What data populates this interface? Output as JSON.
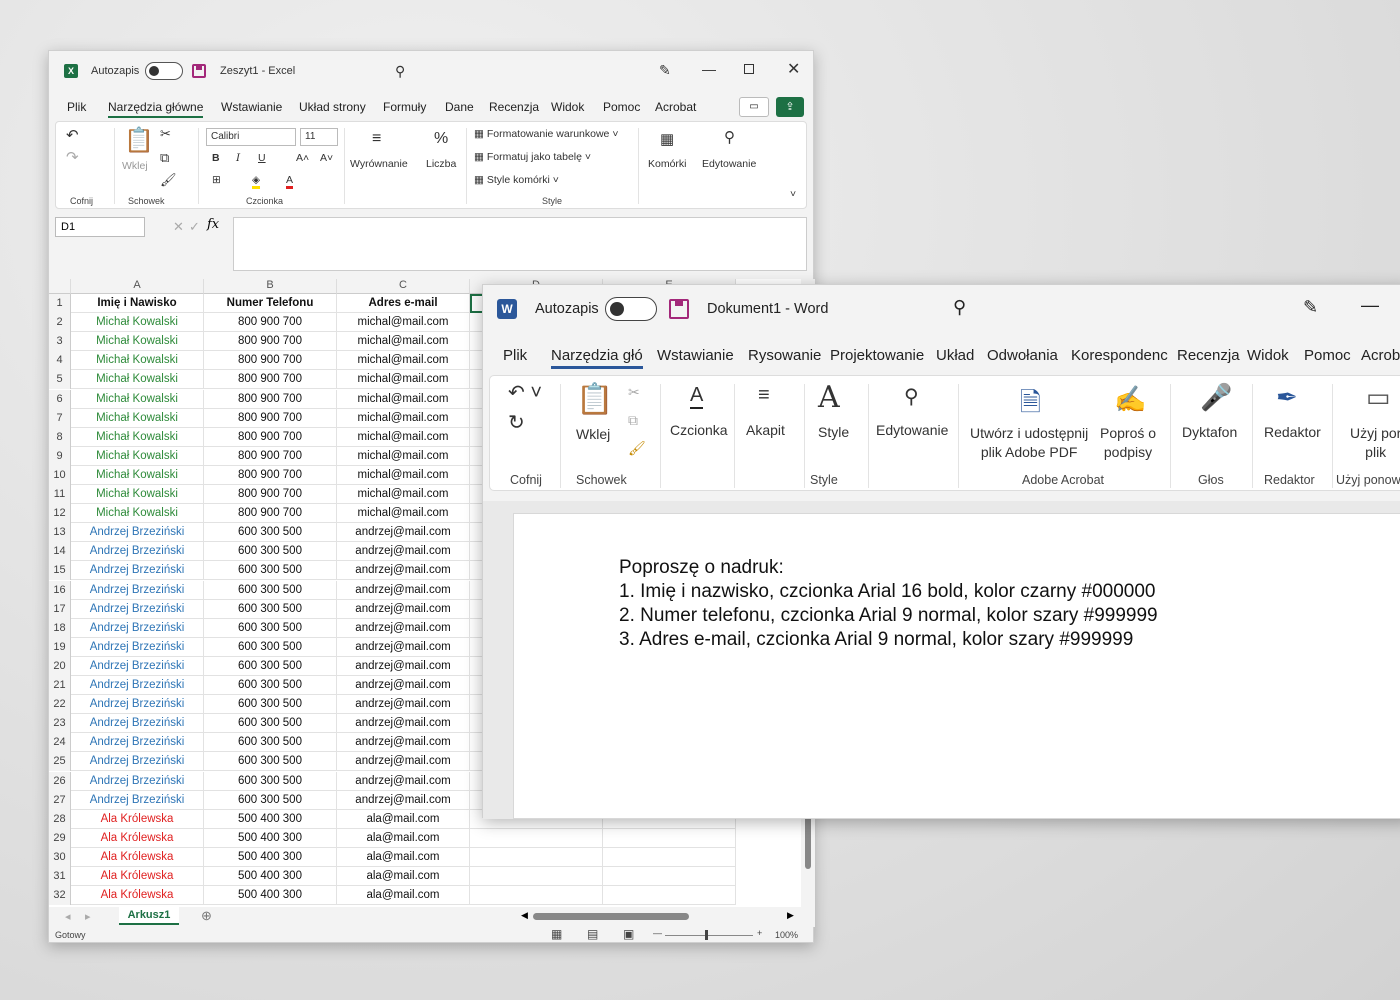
{
  "excel": {
    "app_icon": "excel-icon",
    "autosave_label": "Autozapis",
    "title": "Zeszyt1  -  Excel",
    "tabs": [
      "Plik",
      "Narzędzia główne",
      "Wstawianie",
      "Układ strony",
      "Formuły",
      "Dane",
      "Recenzja",
      "Widok",
      "Pomoc",
      "Acrobat"
    ],
    "ribbon": {
      "font_name": "Calibri",
      "font_size": "11",
      "paste_label": "Wklej",
      "alignment_label": "Wyrównanie",
      "number_label": "Liczba",
      "cond_format": "Formatowanie warunkowe",
      "format_table": "Formatuj jako tabelę",
      "cell_styles": "Style komórki",
      "cells_label": "Komórki",
      "editing_label": "Edytowanie",
      "groups": {
        "undo": "Cofnij",
        "clipboard": "Schowek",
        "font": "Czcionka",
        "style": "Style"
      }
    },
    "namebox": "D1",
    "fx_label": "fx",
    "columns": [
      "A",
      "B",
      "C",
      "D",
      "E"
    ],
    "headers": [
      "Imię i Nawisko",
      "Numer Telefonu",
      "Adres e-mail"
    ],
    "rows": [
      [
        "Michał Kowalski",
        "800 900 700",
        "michal@mail.com",
        "green"
      ],
      [
        "Michał Kowalski",
        "800 900 700",
        "michal@mail.com",
        "green"
      ],
      [
        "Michał Kowalski",
        "800 900 700",
        "michal@mail.com",
        "green"
      ],
      [
        "Michał Kowalski",
        "800 900 700",
        "michal@mail.com",
        "green"
      ],
      [
        "Michał Kowalski",
        "800 900 700",
        "michal@mail.com",
        "green"
      ],
      [
        "Michał Kowalski",
        "800 900 700",
        "michal@mail.com",
        "green"
      ],
      [
        "Michał Kowalski",
        "800 900 700",
        "michal@mail.com",
        "green"
      ],
      [
        "Michał Kowalski",
        "800 900 700",
        "michal@mail.com",
        "green"
      ],
      [
        "Michał Kowalski",
        "800 900 700",
        "michal@mail.com",
        "green"
      ],
      [
        "Michał Kowalski",
        "800 900 700",
        "michal@mail.com",
        "green"
      ],
      [
        "Michał Kowalski",
        "800 900 700",
        "michal@mail.com",
        "green"
      ],
      [
        "Andrzej Brzeziński",
        "600 300 500",
        "andrzej@mail.com",
        "blue"
      ],
      [
        "Andrzej Brzeziński",
        "600 300 500",
        "andrzej@mail.com",
        "blue"
      ],
      [
        "Andrzej Brzeziński",
        "600 300 500",
        "andrzej@mail.com",
        "blue"
      ],
      [
        "Andrzej Brzeziński",
        "600 300 500",
        "andrzej@mail.com",
        "blue"
      ],
      [
        "Andrzej Brzeziński",
        "600 300 500",
        "andrzej@mail.com",
        "blue"
      ],
      [
        "Andrzej Brzeziński",
        "600 300 500",
        "andrzej@mail.com",
        "blue"
      ],
      [
        "Andrzej Brzeziński",
        "600 300 500",
        "andrzej@mail.com",
        "blue"
      ],
      [
        "Andrzej Brzeziński",
        "600 300 500",
        "andrzej@mail.com",
        "blue"
      ],
      [
        "Andrzej Brzeziński",
        "600 300 500",
        "andrzej@mail.com",
        "blue"
      ],
      [
        "Andrzej Brzeziński",
        "600 300 500",
        "andrzej@mail.com",
        "blue"
      ],
      [
        "Andrzej Brzeziński",
        "600 300 500",
        "andrzej@mail.com",
        "blue"
      ],
      [
        "Andrzej Brzeziński",
        "600 300 500",
        "andrzej@mail.com",
        "blue"
      ],
      [
        "Andrzej Brzeziński",
        "600 300 500",
        "andrzej@mail.com",
        "blue"
      ],
      [
        "Andrzej Brzeziński",
        "600 300 500",
        "andrzej@mail.com",
        "blue"
      ],
      [
        "Andrzej Brzeziński",
        "600 300 500",
        "andrzej@mail.com",
        "blue"
      ],
      [
        "Ala Królewska",
        "500 400 300",
        "ala@mail.com",
        "red"
      ],
      [
        "Ala Królewska",
        "500 400 300",
        "ala@mail.com",
        "red"
      ],
      [
        "Ala Królewska",
        "500 400 300",
        "ala@mail.com",
        "red"
      ],
      [
        "Ala Królewska",
        "500 400 300",
        "ala@mail.com",
        "red"
      ],
      [
        "Ala Królewska",
        "500 400 300",
        "ala@mail.com",
        "red"
      ]
    ],
    "name_colors": {
      "green": "#2e8b3a",
      "blue": "#2e75b6",
      "red": "#e02020"
    },
    "sheet_tab": "Arkusz1",
    "status": "Gotowy",
    "zoom": "100%"
  },
  "word": {
    "app_icon": "word-icon",
    "autosave_label": "Autozapis",
    "title": "Dokument1  -  Word",
    "tabs": [
      "Plik",
      "Narzędzia głó",
      "Wstawianie",
      "Rysowanie",
      "Projektowanie",
      "Układ",
      "Odwołania",
      "Korespondenc",
      "Recenzja",
      "Widok",
      "Pomoc",
      "Acrob"
    ],
    "ribbon": {
      "paste": "Wklej",
      "font": "Czcionka",
      "paragraph": "Akapit",
      "style": "Style",
      "editing": "Edytowanie",
      "create_pdf_1": "Utwórz i udostępnij",
      "create_pdf_2": "plik Adobe PDF",
      "request_sign_1": "Poproś o",
      "request_sign_2": "podpisy",
      "dictate": "Dyktafon",
      "editor": "Redaktor",
      "reuse_1": "Użyj por",
      "reuse_2": "plik",
      "groups": {
        "undo": "Cofnij",
        "clipboard": "Schowek",
        "style": "Style",
        "acrobat": "Adobe Acrobat",
        "voice": "Głos",
        "editor": "Redaktor",
        "reuse": "Użyj ponow"
      }
    },
    "document_lines": [
      "Poproszę o nadruk:",
      "1. Imię i nazwisko, czcionka Arial 16 bold,  kolor czarny #000000",
      "2. Numer telefonu, czcionka Arial 9 normal, kolor szary #999999",
      "3. Adres e-mail, czcionka Arial 9 normal, kolor szary #999999"
    ]
  }
}
